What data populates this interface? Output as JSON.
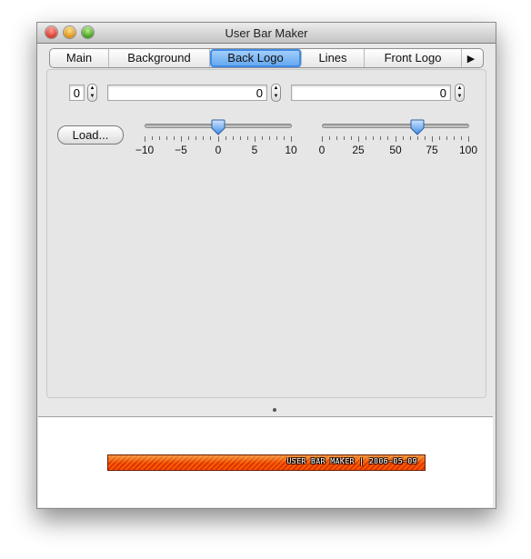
{
  "window": {
    "title": "User Bar Maker"
  },
  "tabs": [
    {
      "label": "Main"
    },
    {
      "label": "Background"
    },
    {
      "label": "Back Logo",
      "active": true
    },
    {
      "label": "Lines"
    },
    {
      "label": "Front Logo"
    }
  ],
  "tab_overflow_icon": "right-arrow-icon",
  "fields": {
    "small_value": "0",
    "x_value": "0",
    "y_value": "0"
  },
  "load_button": {
    "label": "Load..."
  },
  "slider_left": {
    "min": -10,
    "max": 10,
    "value": 0,
    "tick_labels": [
      "−10",
      "−5",
      "0",
      "5",
      "10"
    ]
  },
  "slider_right": {
    "min": 0,
    "max": 100,
    "value": 65,
    "tick_labels": [
      "0",
      "25",
      "50",
      "75",
      "100"
    ]
  },
  "preview": {
    "userbar_text": "USER BAR MAKER | 2006-05-09",
    "colors": {
      "bar_primary": "#ff5a00",
      "bar_secondary": "#d63500"
    }
  },
  "colors": {
    "accent": "#5ea4ef",
    "window_bg": "#e8e8e8"
  }
}
